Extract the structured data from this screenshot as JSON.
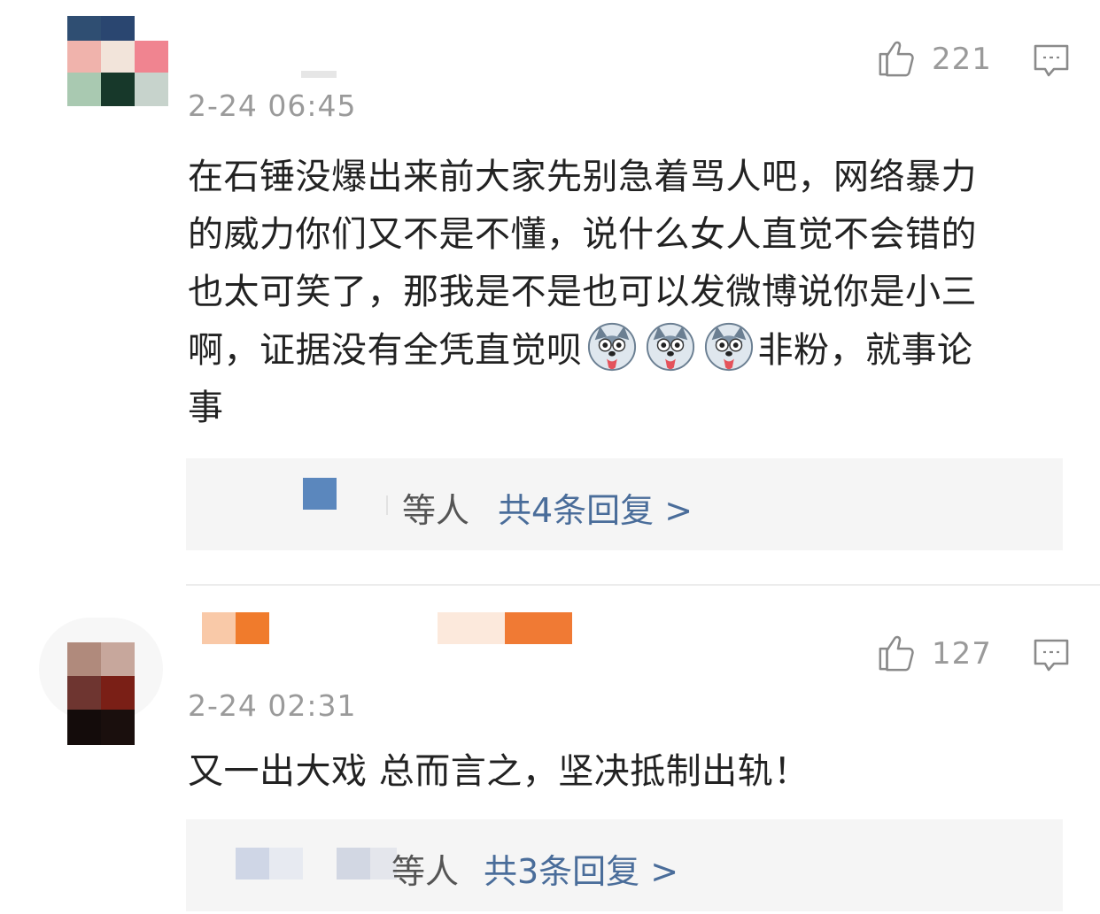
{
  "colors": {
    "link": "#4a6d9a",
    "meta": "#9a9a9a",
    "text": "#222222",
    "reply_bg": "#f5f5f5"
  },
  "comments": [
    {
      "time": "2-24 06:45",
      "likes": "221",
      "lines": [
        "在石锤没爆出来前大家先别急着骂人吧，网络暴力",
        "的威力你们又不是不懂，说什么女人直觉不会错的",
        "也太可笑了，那我是不是也可以发微博说你是小三"
      ],
      "line4_before": "啊，证据没有全凭直觉呗",
      "line4_after": "非粉，就事论",
      "line5": "事",
      "emoji_icon": "husky-emoji-icon",
      "reply_who_suffix": "等人",
      "reply_total": "共4条回复 >"
    },
    {
      "time": "2-24 02:31",
      "likes": "127",
      "text": "又一出大戏 总而言之，坚决抵制出轨！",
      "reply_who_suffix": "等人",
      "reply_total": "共3条回复 >"
    }
  ],
  "icons": {
    "like": "thumbs-up-icon",
    "reply": "comment-bubble-icon"
  }
}
